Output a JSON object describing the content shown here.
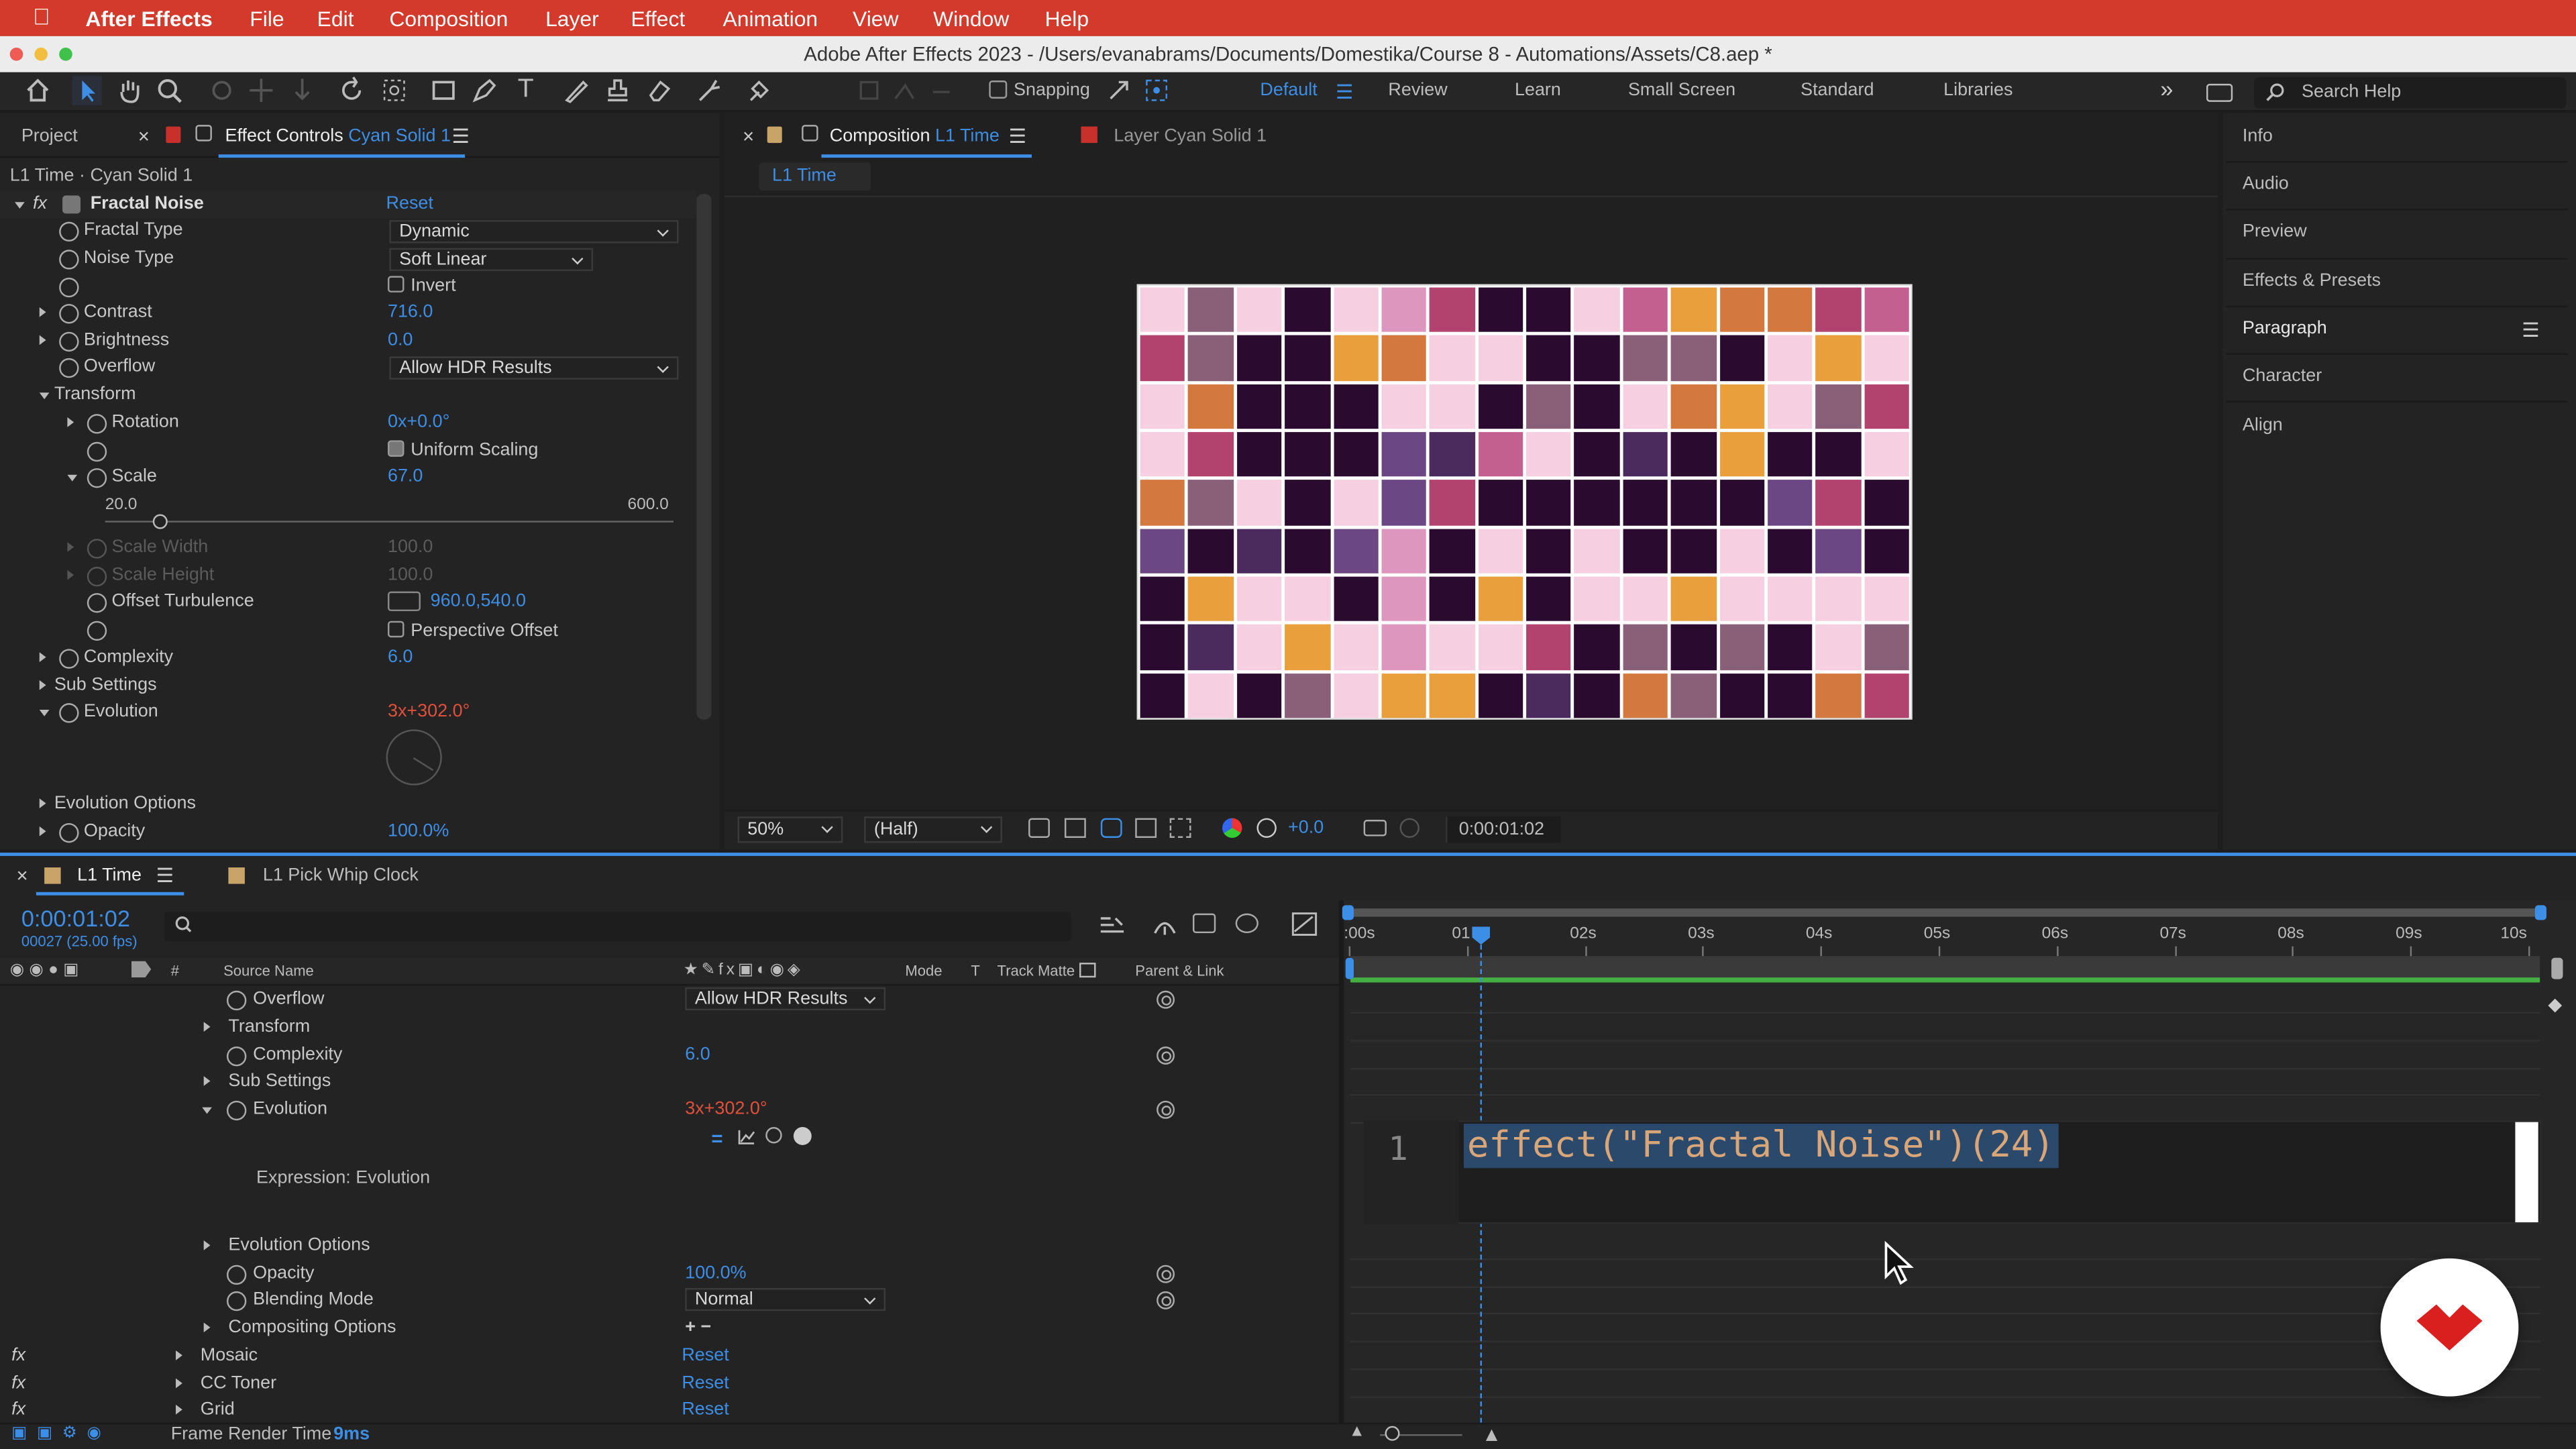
{
  "menubar": {
    "app_name": "After Effects",
    "items": [
      "File",
      "Edit",
      "Composition",
      "Layer",
      "Effect",
      "Animation",
      "View",
      "Window",
      "Help"
    ],
    "bg_color": "#d33a2b"
  },
  "window": {
    "title": "Adobe After Effects 2023 - /Users/evanabrams/Documents/Domestika/Course 8 - Automations/Assets/C8.aep *"
  },
  "toolbar": {
    "snapping_label": "Snapping",
    "workspaces": [
      "Default",
      "Review",
      "Learn",
      "Small Screen",
      "Standard",
      "Libraries"
    ],
    "active_workspace": "Default",
    "search_placeholder": "Search Help",
    "accent": "#3d8ee6"
  },
  "effect_controls": {
    "tab_project": "Project",
    "tab_prefix": "Effect Controls",
    "tab_layer": "Cyan Solid 1",
    "subtitle": "L1 Time · Cyan Solid 1",
    "effect_name": "Fractal Noise",
    "reset_label": "Reset",
    "fractal_type_label": "Fractal Type",
    "fractal_type_value": "Dynamic",
    "noise_type_label": "Noise Type",
    "noise_type_value": "Soft Linear",
    "invert_label": "Invert",
    "contrast_label": "Contrast",
    "contrast_value": "716.0",
    "brightness_label": "Brightness",
    "brightness_value": "0.0",
    "overflow_label": "Overflow",
    "overflow_value": "Allow HDR Results",
    "transform_label": "Transform",
    "rotation_label": "Rotation",
    "rotation_value": "0x+0.0°",
    "uniform_scaling_label": "Uniform Scaling",
    "scale_label": "Scale",
    "scale_value": "67.0",
    "slider_min": "20.0",
    "slider_max": "600.0",
    "scale_width_label": "Scale Width",
    "scale_width_value": "100.0",
    "scale_height_label": "Scale Height",
    "scale_height_value": "100.0",
    "offset_label": "Offset Turbulence",
    "offset_value": "960.0,540.0",
    "perspective_label": "Perspective Offset",
    "complexity_label": "Complexity",
    "complexity_value": "6.0",
    "sub_settings_label": "Sub Settings",
    "evolution_label": "Evolution",
    "evolution_value": "3x+302.0°",
    "evolution_options_label": "Evolution Options",
    "opacity_label": "Opacity",
    "opacity_value": "100.0%"
  },
  "composition": {
    "tab_prefix": "Composition",
    "tab_name": "L1 Time",
    "layer_tab_prefix": "Layer",
    "layer_tab_name": "Cyan Solid 1",
    "breadcrumb": "L1 Time",
    "zoom": "50%",
    "resolution": "(Half)",
    "exposure": "+0.0",
    "timecode": "0:00:01:02"
  },
  "right_panel": {
    "items": [
      "Info",
      "Audio",
      "Preview",
      "Effects & Presets",
      "Paragraph",
      "Character",
      "Align"
    ]
  },
  "timeline": {
    "tab_name": "L1 Time",
    "tab2_name": "L1 Pick Whip Clock",
    "timecode": "0:00:01:02",
    "frame_info": "00027 (25.00 fps)",
    "columns": {
      "source_name": "Source Name",
      "mode": "Mode",
      "t": "T",
      "track_matte": "Track Matte",
      "parent": "Parent & Link",
      "hash": "#"
    },
    "ruler_labels": [
      ":00s",
      "01",
      "02s",
      "03s",
      "04s",
      "05s",
      "06s",
      "07s",
      "08s",
      "09s",
      "10s"
    ],
    "rows": {
      "overflow_label": "Overflow",
      "overflow_value": "Allow HDR Results",
      "transform_label": "Transform",
      "complexity_label": "Complexity",
      "complexity_value": "6.0",
      "sub_settings_label": "Sub Settings",
      "evolution_label": "Evolution",
      "evolution_value": "3x+302.0°",
      "expression_label": "Expression: Evolution",
      "evolution_options_label": "Evolution Options",
      "opacity_label": "Opacity",
      "opacity_value": "100.0%",
      "blending_label": "Blending Mode",
      "blending_value": "Normal",
      "compositing_label": "Compositing Options",
      "mosaic_label": "Mosaic",
      "cctoner_label": "CC Toner",
      "grid_label": "Grid",
      "reset_label": "Reset"
    },
    "expression_line_number": "1",
    "expression_code": "effect(\"Fractal Noise\")(24)",
    "frame_render_label": "Frame Render Time",
    "frame_render_value": "9ms"
  },
  "mosaic_palette": {
    "0": "#2a0a2e",
    "1": "#f6cfe0",
    "2": "#e9a03c",
    "3": "#b2426e",
    "4": "#8a5f78",
    "5": "#d3783f",
    "6": "#4b2b5e",
    "7": "#c46090",
    "8": "#6b4784",
    "9": "#dd96be"
  },
  "mosaic_grid": [
    "1410193001725537",
    "3400251100440121",
    "1500011040152143",
    "1300086710602001",
    "5410183000000830",
    "8060890101001080",
    "0211090201121111",
    "0612191130404014",
    "0104122060540053"
  ]
}
